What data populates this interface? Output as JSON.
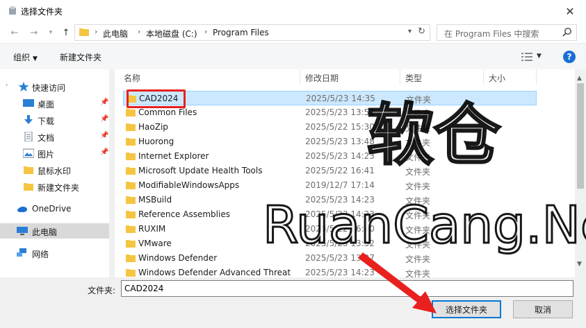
{
  "window": {
    "title": "选择文件夹",
    "close_glyph": "✕"
  },
  "address": {
    "crumbs": [
      "此电脑",
      "本地磁盘 (C:)",
      "Program Files"
    ],
    "search_placeholder": "在 Program Files 中搜索"
  },
  "toolbar": {
    "organize_label": "组织",
    "new_folder_label": "新建文件夹"
  },
  "nav": {
    "items": [
      {
        "label": "快速访问",
        "icon": "star-icon"
      },
      {
        "label": "桌面",
        "icon": "desktop-icon",
        "pinned": true
      },
      {
        "label": "下载",
        "icon": "download-icon",
        "pinned": true
      },
      {
        "label": "文档",
        "icon": "document-icon",
        "pinned": true
      },
      {
        "label": "图片",
        "icon": "picture-icon",
        "pinned": true
      },
      {
        "label": "鼠标水印",
        "icon": "folder-icon"
      },
      {
        "label": "新建文件夹",
        "icon": "folder-icon"
      },
      {
        "label": "OneDrive",
        "icon": "cloud-icon"
      },
      {
        "label": "此电脑",
        "icon": "computer-icon",
        "selected": true
      },
      {
        "label": "网络",
        "icon": "network-icon"
      }
    ]
  },
  "columns": {
    "name": "名称",
    "date": "修改日期",
    "type": "类型",
    "size": "大小"
  },
  "files": [
    {
      "name": "CAD2024",
      "date": "2025/5/23 14:35",
      "type": "文件夹",
      "selected": true
    },
    {
      "name": "Common Files",
      "date": "2025/5/23 13:52",
      "type": "文件夹"
    },
    {
      "name": "HaoZip",
      "date": "2025/5/22 15:30",
      "type": "文件夹"
    },
    {
      "name": "Huorong",
      "date": "2025/5/23 13:48",
      "type": "文件夹"
    },
    {
      "name": "Internet Explorer",
      "date": "2025/5/23 14:23",
      "type": "文件夹"
    },
    {
      "name": "Microsoft Update Health Tools",
      "date": "2025/5/22 16:41",
      "type": "文件夹"
    },
    {
      "name": "ModifiableWindowsApps",
      "date": "2019/12/7 17:14",
      "type": "文件夹"
    },
    {
      "name": "MSBuild",
      "date": "2025/5/23 14:23",
      "type": "文件夹"
    },
    {
      "name": "Reference Assemblies",
      "date": "2025/5/23 14:23",
      "type": "文件夹"
    },
    {
      "name": "RUXIM",
      "date": "2025/5/22 16:40",
      "type": "文件夹"
    },
    {
      "name": "VMware",
      "date": "2025/5/23 13:52",
      "type": "文件夹"
    },
    {
      "name": "Windows Defender",
      "date": "2025/5/23 13:37",
      "type": "文件夹"
    },
    {
      "name": "Windows Defender Advanced Threat",
      "date": "2025/5/23 14:23",
      "type": "文件夹"
    }
  ],
  "bottom": {
    "folder_label": "文件夹:",
    "folder_value": "CAD2024",
    "select_button": "选择文件夹",
    "cancel_button": "取消"
  },
  "watermark": {
    "line1": "软仓",
    "line2": "RuanCang.Net"
  },
  "colors": {
    "accent": "#0078d7",
    "selection": "#cce8ff",
    "annotation": "#e8201e",
    "folder": "#f5c542"
  }
}
